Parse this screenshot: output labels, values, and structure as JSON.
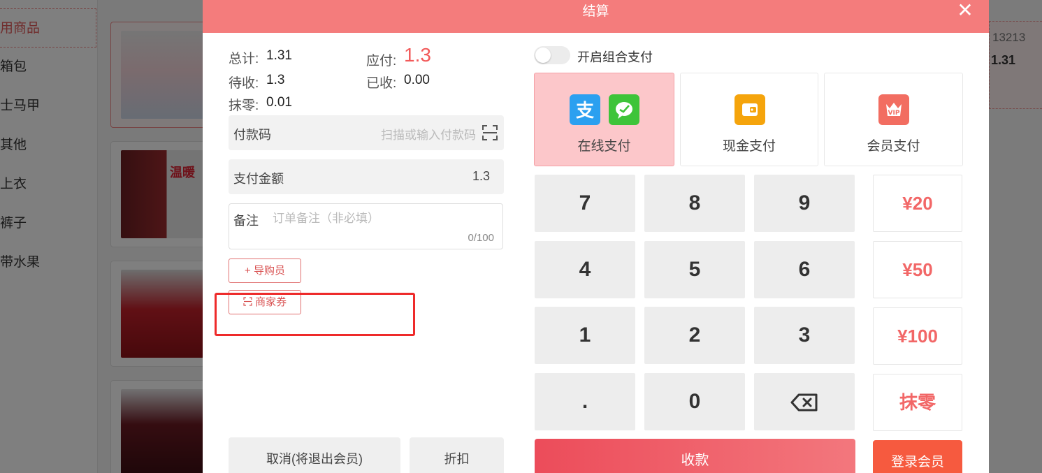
{
  "background": {
    "categories": [
      "用商品",
      "箱包",
      "士马甲",
      "其他",
      "上衣",
      "裤子",
      "带水果"
    ],
    "right_card": {
      "code": "13213",
      "price": "1.31"
    },
    "card_badge": "温暖"
  },
  "modal": {
    "title": "结算",
    "summary": {
      "total_label": "总计:",
      "total_value": "1.31",
      "due_label": "应付:",
      "due_value": "1.3",
      "pending_label": "待收:",
      "pending_value": "1.3",
      "received_label": "已收:",
      "received_value": "0.00",
      "rounding_label": "抹零:",
      "rounding_value": "0.01"
    },
    "payment_code": {
      "label": "付款码",
      "placeholder": "扫描或输入付款码"
    },
    "pay_amount": {
      "label": "支付金额",
      "value": "1.3"
    },
    "remark": {
      "label": "备注",
      "placeholder": "订单备注（非必填）",
      "counter": "0/100"
    },
    "guide_button": {
      "icon": "+",
      "label": "导购员"
    },
    "coupon_button": {
      "label": "商家券"
    },
    "cancel_button": "取消(将退出会员)",
    "discount_button": "折扣",
    "combo_toggle": {
      "label": "开启组合支付",
      "on": false
    },
    "pay_methods": [
      {
        "label": "在线支付",
        "active": true
      },
      {
        "label": "现金支付",
        "active": false
      },
      {
        "label": "会员支付",
        "active": false
      }
    ],
    "keypad": [
      "7",
      "8",
      "9",
      "4",
      "5",
      "6",
      "1",
      "2",
      "3",
      ".",
      "0"
    ],
    "quick_amounts": [
      "¥20",
      "¥50",
      "¥100",
      "抹零"
    ],
    "collect_button": "收款",
    "login_member_button": "登录会员",
    "colors": {
      "header": "#f47c7c",
      "accent": "#f25a5a",
      "alipay": "#2ba0f0",
      "wechat": "#3ec439",
      "cash": "#f5a40c",
      "vip": "#f26d61"
    }
  }
}
